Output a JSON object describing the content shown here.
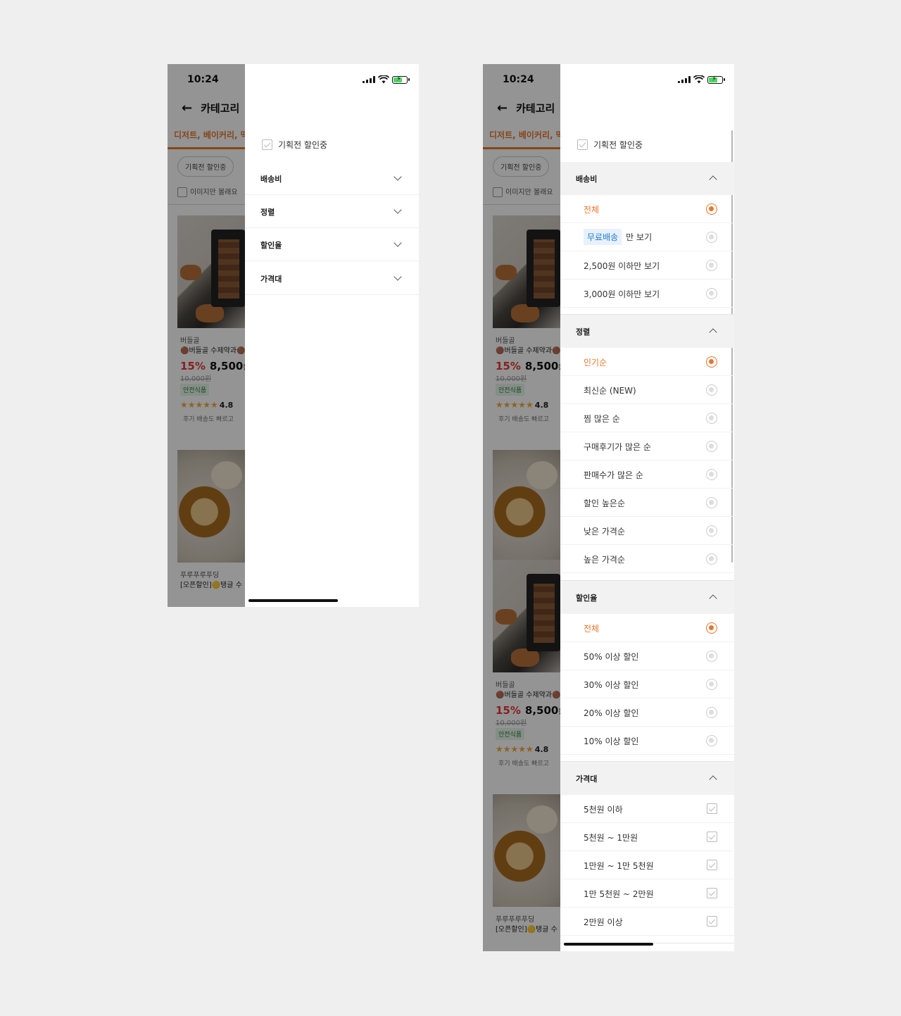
{
  "status_bar": {
    "time": "10:24"
  },
  "background_app": {
    "header_title": "카테고리",
    "back_icon": "←",
    "category_text": "디저트, 베이커리, 떡",
    "chip_label": "기획전 할인중",
    "image_only_label": "이미지만 볼래요",
    "products": [
      {
        "brand": "버들골",
        "name": "🟤버들골 수제약과🟤",
        "discount": "15%",
        "price": "8,500",
        "unit": "원",
        "original_price": "10,000원",
        "badge": "안전식품",
        "stars": "★★★★★",
        "rating": "4.8",
        "review": "후기   배송도 빠르고"
      },
      {
        "brand": "푸루푸루푸딩",
        "name": "[오픈할인]🟡탱글 수"
      }
    ]
  },
  "drawer": {
    "promo_label": "기획전 할인중",
    "sections": [
      {
        "title": "배송비"
      },
      {
        "title": "정렬"
      },
      {
        "title": "할인율"
      },
      {
        "title": "가격대"
      }
    ]
  },
  "expanded": {
    "shipping": {
      "title": "배송비",
      "options": [
        "전체",
        "만 보기",
        "2,500원 이하만 보기",
        "3,000원 이하만 보기"
      ],
      "free_tag": "무료배송",
      "selected": "전체"
    },
    "sort": {
      "title": "정렬",
      "options": [
        "인기순",
        "최신순 (NEW)",
        "찜 많은 순",
        "구매후기가 많은 순",
        "판매수가 많은 순",
        "할인 높은순",
        "낮은 가격순",
        "높은 가격순"
      ],
      "selected": "인기순"
    },
    "discount": {
      "title": "할인율",
      "options": [
        "전체",
        "50% 이상 할인",
        "30% 이상 할인",
        "20% 이상 할인",
        "10% 이상 할인"
      ],
      "selected": "전체"
    },
    "price": {
      "title": "가격대",
      "options": [
        "5천원 이하",
        "5천원 ~ 1만원",
        "1만원 ~ 1만 5천원",
        "1만 5천원 ~ 2만원",
        "2만원 이상"
      ]
    }
  },
  "colors": {
    "accent": "#e8772e",
    "tag_blue": "#1e7bd0",
    "tag_bg": "#e8f1fb",
    "dim_overlay": "rgba(0,0,0,0.42)"
  }
}
